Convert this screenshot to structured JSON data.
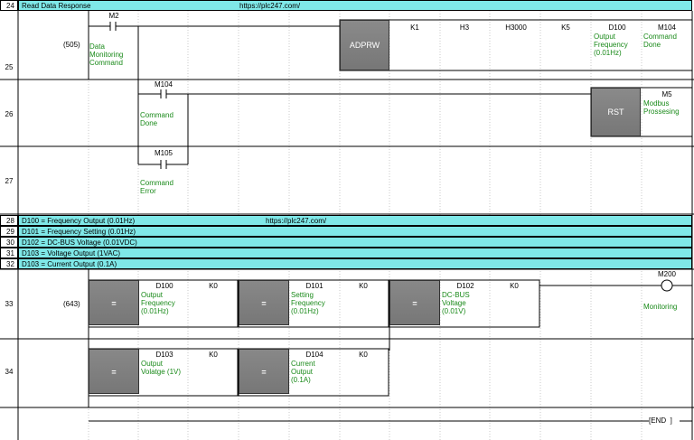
{
  "rows": {
    "r24": {
      "num": "24",
      "title": "Read Data Response",
      "url": "https://plc247.com/"
    },
    "r25": {
      "num": "25",
      "step": "(505)",
      "contact": "M2",
      "comment": [
        "Data",
        "Monitoring",
        "Command"
      ],
      "instr": "ADPRW",
      "ops": [
        "K1",
        "H3",
        "H3000",
        "K5",
        "D100",
        "M104"
      ],
      "op_comments": {
        "d100": [
          "Output",
          "Frequency",
          "(0.01Hz)"
        ],
        "m104": [
          "Command",
          "Done"
        ]
      }
    },
    "r26": {
      "num": "26",
      "contact": "M104",
      "comment": [
        "Command",
        "Done"
      ],
      "instr": "RST",
      "coil": "M5",
      "coil_comment": [
        "Modbus",
        "Prossesing"
      ]
    },
    "r27": {
      "num": "27",
      "contact": "M105",
      "comment": [
        "Command",
        "Error"
      ]
    },
    "r28": {
      "num": "28",
      "text": "D100 = Frequency Output (0.01Hz)",
      "url": "https://plc247.com/"
    },
    "r29": {
      "num": "29",
      "text": "D101 = Frequency Setting (0.01Hz)"
    },
    "r30": {
      "num": "30",
      "text": "D102 = DC-BUS Voltage (0.01VDC)"
    },
    "r31": {
      "num": "31",
      "text": "D103 = Voltage Output (1VAC)"
    },
    "r32": {
      "num": "32",
      "text": "D103 = Current Output (0.1A)"
    },
    "r33": {
      "num": "33",
      "step": "(643)",
      "coil": "M200",
      "coil_comment": "Monitoring",
      "cmps": [
        {
          "op": "=",
          "dev": "D100",
          "k": "K0",
          "comment": [
            "Output",
            "Frequency",
            "(0.01Hz)"
          ]
        },
        {
          "op": "=",
          "dev": "D101",
          "k": "K0",
          "comment": [
            "Setting",
            "Frequency",
            "(0.01Hz)"
          ]
        },
        {
          "op": "=",
          "dev": "D102",
          "k": "K0",
          "comment": [
            "DC-BUS",
            "Voltage",
            "(0.01V)"
          ]
        }
      ]
    },
    "r34": {
      "num": "34",
      "cmps": [
        {
          "op": "=",
          "dev": "D103",
          "k": "K0",
          "comment": [
            "Output",
            "Volatge (1V)"
          ]
        },
        {
          "op": "=",
          "dev": "D104",
          "k": "K0",
          "comment": [
            "Current",
            "Output",
            "(0.1A)"
          ]
        }
      ]
    },
    "end": {
      "label": "END"
    }
  }
}
